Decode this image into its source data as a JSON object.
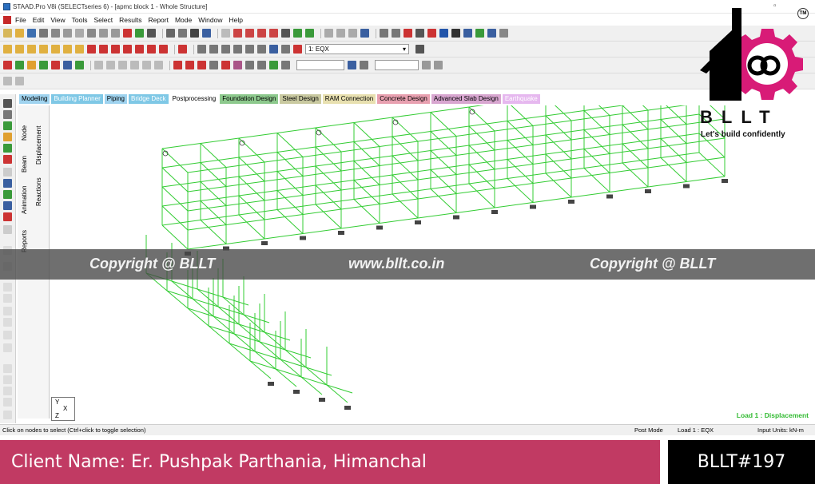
{
  "window": {
    "title": "STAAD.Pro V8i (SELECTseries 6) - [apmc block 1 - Whole Structure]"
  },
  "menu": [
    "File",
    "Edit",
    "View",
    "Tools",
    "Select",
    "Results",
    "Report",
    "Mode",
    "Window",
    "Help"
  ],
  "toolbar": {
    "load_case": "1: EQX"
  },
  "page_tabs": [
    {
      "label": "Modeling",
      "color": "#9fd3ef"
    },
    {
      "label": "Building Planner",
      "color": "#7fc8e6"
    },
    {
      "label": "Piping",
      "color": "#9fd3ef"
    },
    {
      "label": "Bridge Deck",
      "color": "#7fc8e6"
    },
    {
      "label": "Postprocessing",
      "color": "#ffffff"
    },
    {
      "label": "Foundation Design",
      "color": "#8dc98d"
    },
    {
      "label": "Steel Design",
      "color": "#c9c9a0"
    },
    {
      "label": "RAM Connection",
      "color": "#e8e0b0"
    },
    {
      "label": "Concrete Design",
      "color": "#e8a0b0"
    },
    {
      "label": "Advanced Slab Design",
      "color": "#d8a6d0"
    },
    {
      "label": "Earthquake",
      "color": "#e6b8ef"
    }
  ],
  "side_tabs": {
    "node": "Node",
    "beam": "Beam",
    "animation": "Animation",
    "reports": "Reports",
    "displacement": "Displacement",
    "reactions": "Reactions"
  },
  "viewport": {
    "load_label": "Load 1 : Displacement",
    "axis_x": "X",
    "axis_y": "Y",
    "axis_z": "Z"
  },
  "status": {
    "hint": "Click on nodes to select (Ctrl+click to toggle selection)",
    "mode": "Post Mode",
    "load": "Load 1 : EQX",
    "units": "Input Units:  kN-m"
  },
  "watermark": {
    "left": "Copyright @ BLLT",
    "center": "www.bllt.co.in",
    "right": "Copyright @ BLLT"
  },
  "logo": {
    "name": "BLLT",
    "tagline": "Let's build confidently",
    "tm": "TM"
  },
  "banner": {
    "client": "Client Name: Er. Pushpak Parthania, Himanchal",
    "id": "BLLT#197"
  },
  "colors": {
    "accent": "#c13a63",
    "frame_green": "#33cc33",
    "watermark_band": "#464646"
  }
}
